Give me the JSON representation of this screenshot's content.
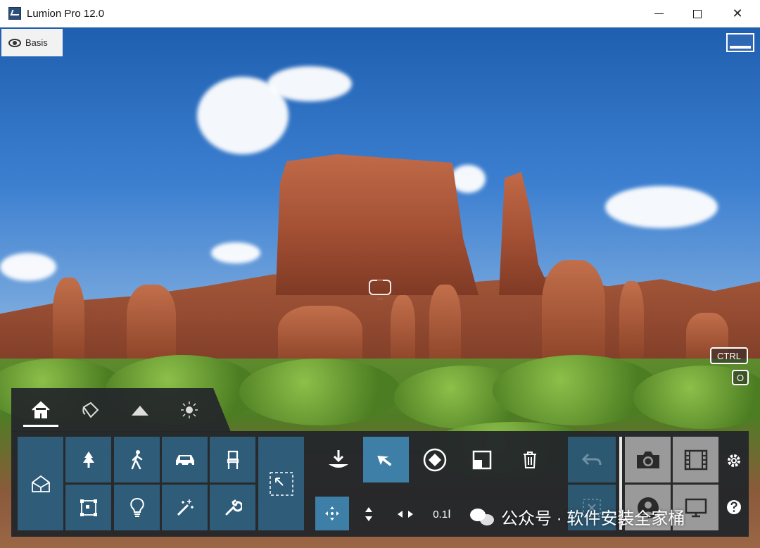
{
  "window": {
    "title": "Lumion Pro 12.0"
  },
  "viewport": {
    "view_mode_label": "Basis",
    "key_hints": [
      "CTRL",
      "O"
    ]
  },
  "dock": {
    "tabs": [
      {
        "name": "home",
        "icon": "home-icon",
        "active": true
      },
      {
        "name": "materials",
        "icon": "paint-bucket-icon",
        "active": false
      },
      {
        "name": "landscape",
        "icon": "mountain-icon",
        "active": false
      },
      {
        "name": "weather",
        "icon": "sun-icon",
        "active": false
      }
    ],
    "object_library": [
      "house-icon",
      "tree-icon",
      "walking-person-icon",
      "car-icon",
      "chair-icon",
      "box-select-icon",
      "light-bulb-icon",
      "magic-wand-icon",
      "wrench-icon"
    ],
    "label_move_numeric": "0.1"
  },
  "watermark": {
    "text": "公众号 · 软件安装全家桶"
  },
  "colors": {
    "tile": "#2f5c78",
    "tile_active": "#3d7fa6",
    "dock_bg": "#23262a"
  }
}
